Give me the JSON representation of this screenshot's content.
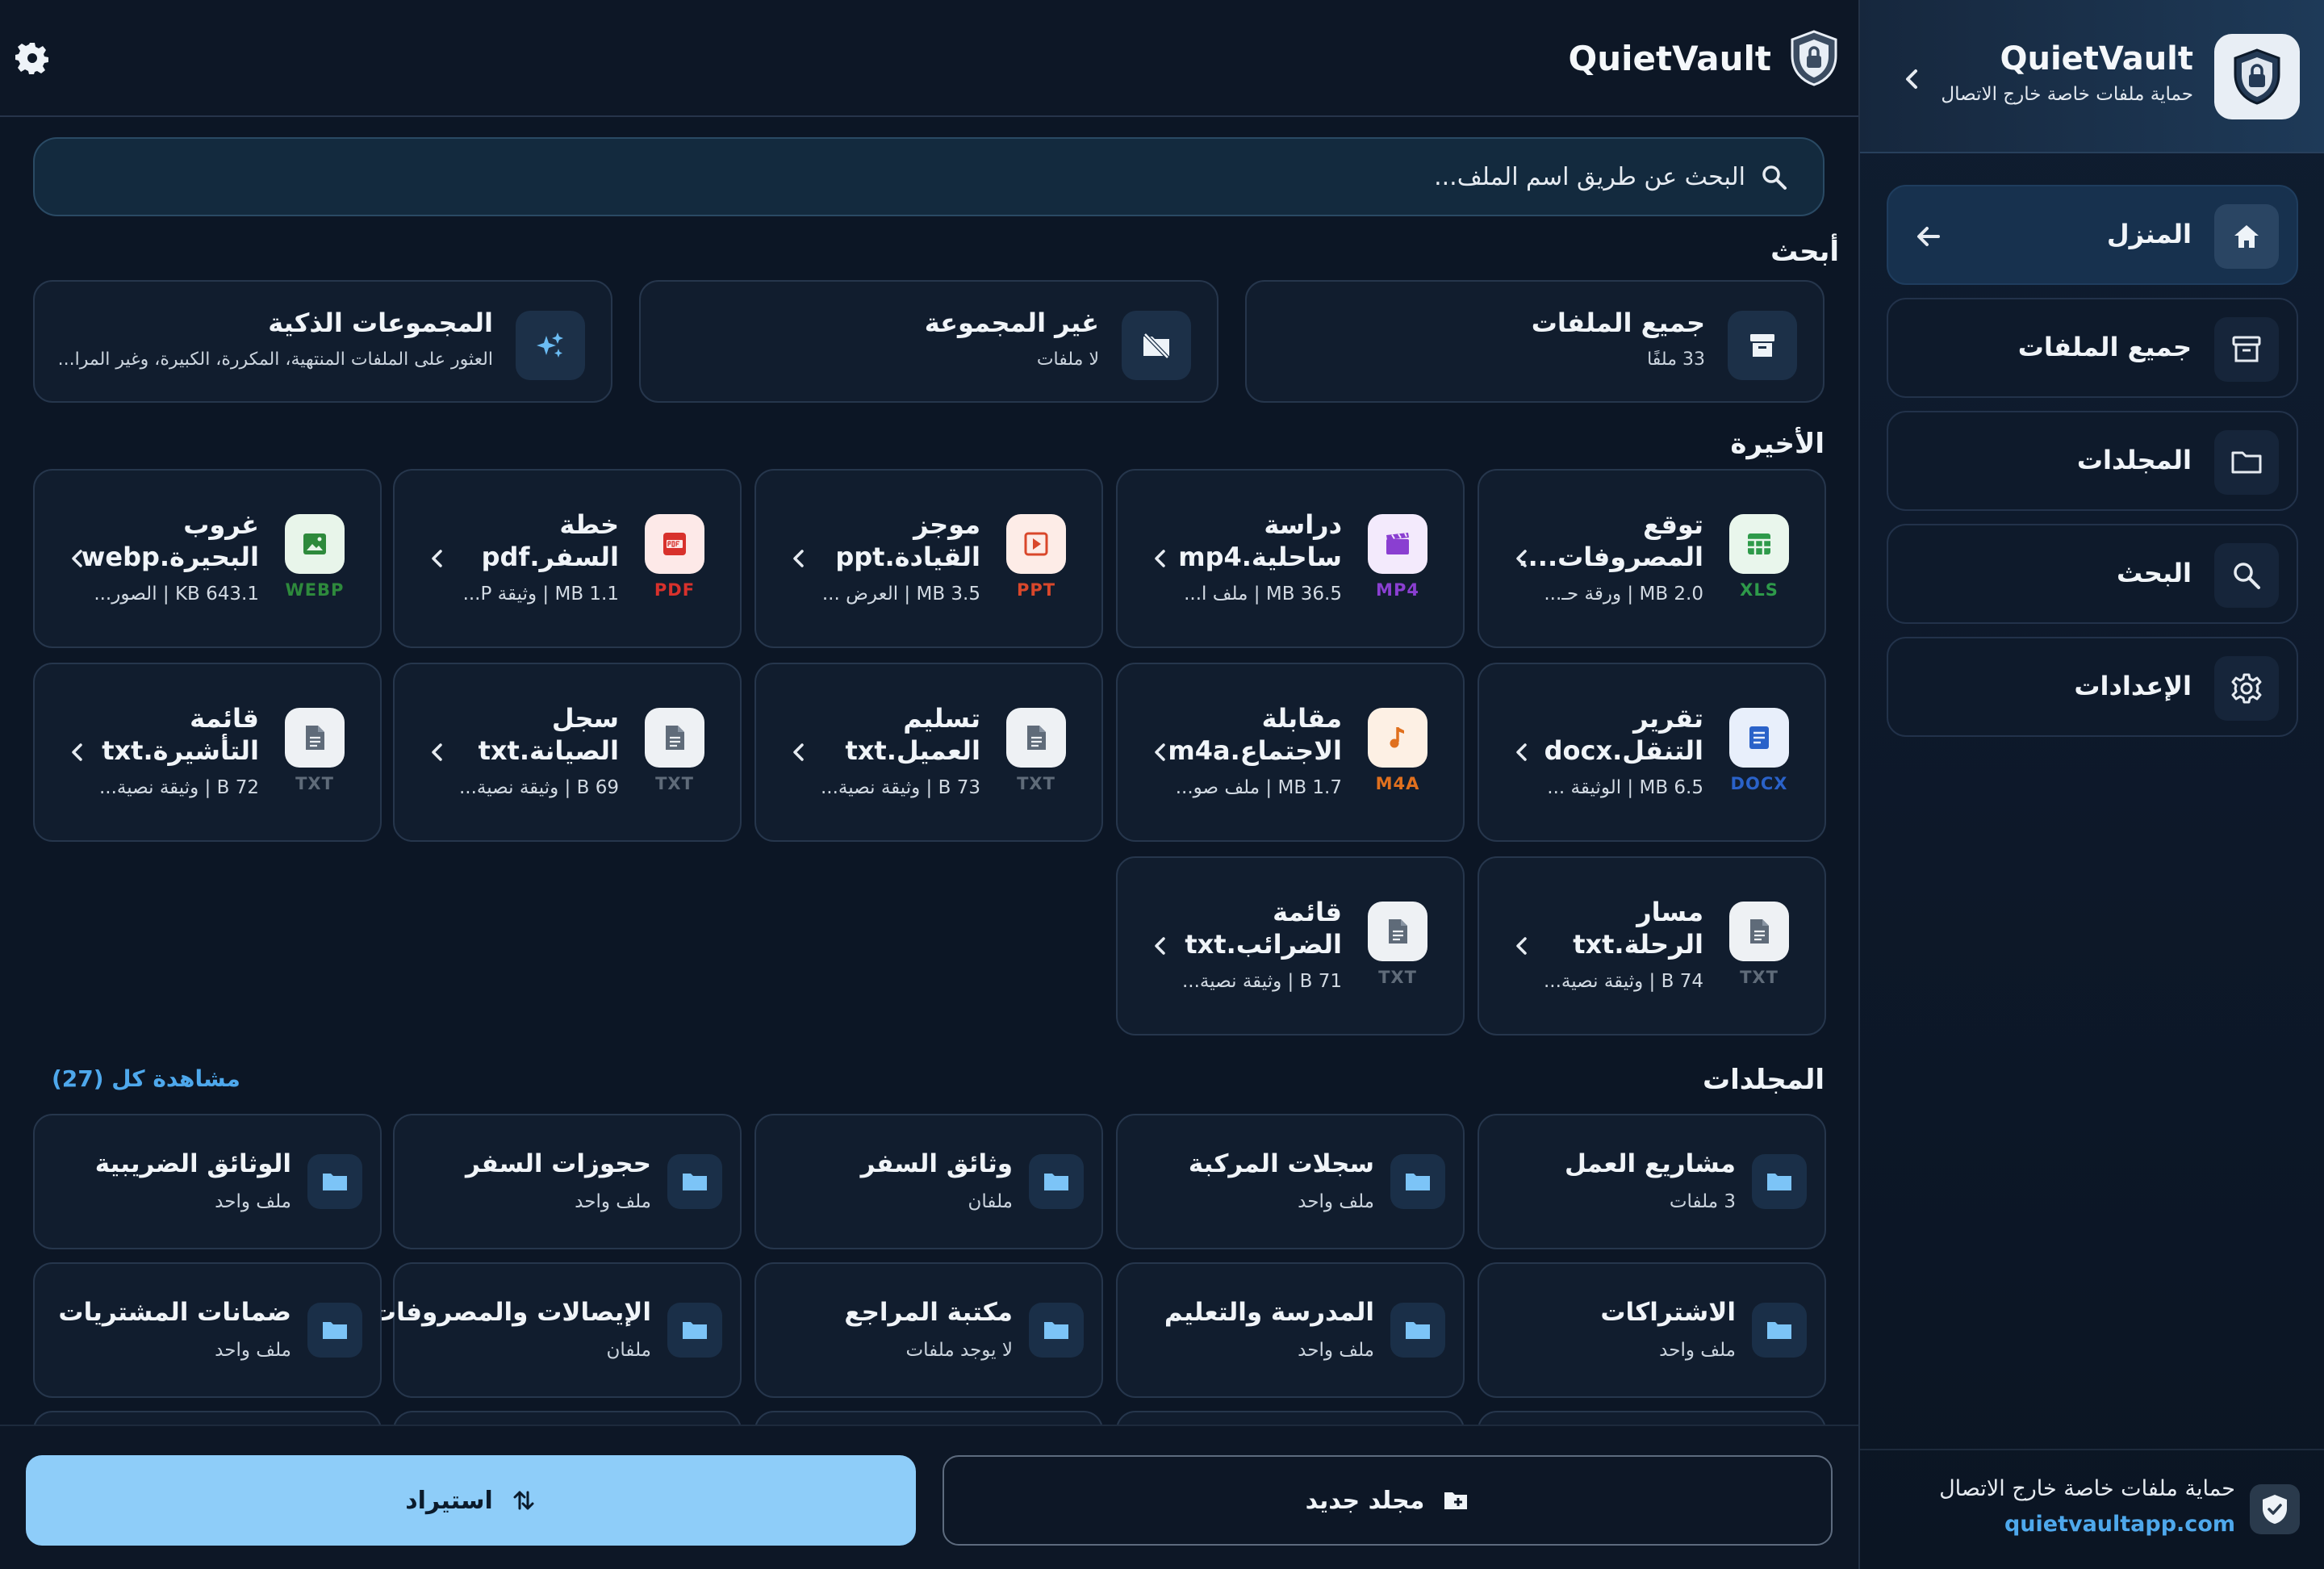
{
  "app": {
    "title": "QuietVault",
    "subtitle": "حماية ملفات خاصة خارج الاتصال"
  },
  "colors": {
    "background": "#0c1625",
    "card": "#111d2e",
    "accent": "#4ea8ec",
    "primary_button": "#8ecdf9"
  },
  "sidebar": {
    "items": [
      {
        "label": "المنزل",
        "icon": "home-icon",
        "active": true
      },
      {
        "label": "جميع الملفات",
        "icon": "archive-icon"
      },
      {
        "label": "المجلدات",
        "icon": "folder-icon"
      },
      {
        "label": "البحث",
        "icon": "search-icon"
      },
      {
        "label": "الإعدادات",
        "icon": "gear-icon"
      }
    ],
    "footer_text": "حماية ملفات خاصة خارج الاتصال",
    "footer_link": "quietvaultapp.com"
  },
  "search": {
    "placeholder": "البحث عن طريق اسم الملف..."
  },
  "browse": {
    "title": "أبحث",
    "cards": [
      {
        "title": "جميع الملفات",
        "subtitle": "33 ملفًا",
        "icon": "archive-icon"
      },
      {
        "title": "غير المجموعة",
        "subtitle": "لا ملفات",
        "icon": "folder-off-icon"
      },
      {
        "title": "المجموعات الذكية",
        "subtitle": "العثور على الملفات المنتهية، المكررة، الكبيرة، وغير المرا...",
        "icon": "sparkle-icon"
      }
    ]
  },
  "recent": {
    "title": "الأخيرة",
    "files": [
      {
        "line1": "توقع",
        "line2": "المصروفات....",
        "meta": "2.0 MB | ورقة حـ...",
        "ext": "XLS",
        "icon": "spreadsheet-icon",
        "color": "#2e9a4a",
        "bg": "#e9f6ec"
      },
      {
        "line1": "دراسة",
        "line2": "ساحلية.mp4",
        "meta": "36.5 MB | ملف ا...",
        "ext": "MP4",
        "icon": "video-icon",
        "color": "#8a3fd1",
        "bg": "#f3eafc"
      },
      {
        "line1": "موجز",
        "line2": "القيادة.ppt",
        "meta": "3.5 MB | العرض ...",
        "ext": "PPT",
        "icon": "slides-icon",
        "color": "#d9472b",
        "bg": "#fdece7"
      },
      {
        "line1": "خطة",
        "line2": "السفر.pdf",
        "meta": "1.1 MB | وثيقة P...",
        "ext": "PDF",
        "icon": "pdf-icon",
        "color": "#d8312c",
        "bg": "#fde9e8"
      },
      {
        "line1": "غروب",
        "line2": "البحيرة.webp",
        "meta": "643.1 KB | الصور...",
        "ext": "WEBP",
        "icon": "image-icon",
        "color": "#2e8a3c",
        "bg": "#e8f5ea"
      },
      {
        "line1": "تقرير",
        "line2": "التنقل.docx",
        "meta": "6.5 MB | الوثيقة ...",
        "ext": "DOCX",
        "icon": "doc-icon",
        "color": "#2a62c9",
        "bg": "#e8effb"
      },
      {
        "line1": "مقابلة",
        "line2": "الاجتماع.m4a",
        "meta": "1.7 MB | ملف صو...",
        "ext": "M4A",
        "icon": "audio-icon",
        "color": "#e0701e",
        "bg": "#fdf0e4"
      },
      {
        "line1": "تسليم",
        "line2": "العميل.txt",
        "meta": "73 B | وثيقة نصية...",
        "ext": "TXT",
        "icon": "text-file-icon",
        "color": "#5f6b79",
        "bg": "#eef1f4"
      },
      {
        "line1": "سجل",
        "line2": "الصيانة.txt",
        "meta": "69 B | وثيقة نصية...",
        "ext": "TXT",
        "icon": "text-file-icon",
        "color": "#5f6b79",
        "bg": "#eef1f4"
      },
      {
        "line1": "قائمة",
        "line2": "التأشيرة.txt",
        "meta": "72 B | وثيقة نصية...",
        "ext": "TXT",
        "icon": "text-file-icon",
        "color": "#5f6b79",
        "bg": "#eef1f4"
      },
      {
        "line1": "مسار",
        "line2": "الرحلة.txt",
        "meta": "74 B | وثيقة نصية...",
        "ext": "TXT",
        "icon": "text-file-icon",
        "color": "#5f6b79",
        "bg": "#eef1f4"
      },
      {
        "line1": "قائمة",
        "line2": "الضرائب.txt",
        "meta": "71 B | وثيقة نصية...",
        "ext": "TXT",
        "icon": "text-file-icon",
        "color": "#5f6b79",
        "bg": "#eef1f4"
      }
    ]
  },
  "folders": {
    "title": "المجلدات",
    "see_all": "مشاهدة كل (27)",
    "items": [
      {
        "name": "مشاريع العمل",
        "count": "3 ملفات"
      },
      {
        "name": "سجلات المركبة",
        "count": "ملف واحد"
      },
      {
        "name": "وثائق السفر",
        "count": "ملفان"
      },
      {
        "name": "حجوزات السفر",
        "count": "ملف واحد"
      },
      {
        "name": "الوثائق الضريبية",
        "count": "ملف واحد"
      },
      {
        "name": "الاشتراكات",
        "count": "ملف واحد"
      },
      {
        "name": "المدرسة والتعليم",
        "count": "ملف واحد"
      },
      {
        "name": "مكتبة المراجع",
        "count": "لا يوجد ملفات"
      },
      {
        "name": "الإيصالات والمصروفات",
        "count": "ملفان"
      },
      {
        "name": "ضمانات المشتريات",
        "count": "ملف واحد"
      }
    ]
  },
  "actions": {
    "import": "استيراد",
    "new_folder": "مجلد جديد"
  }
}
